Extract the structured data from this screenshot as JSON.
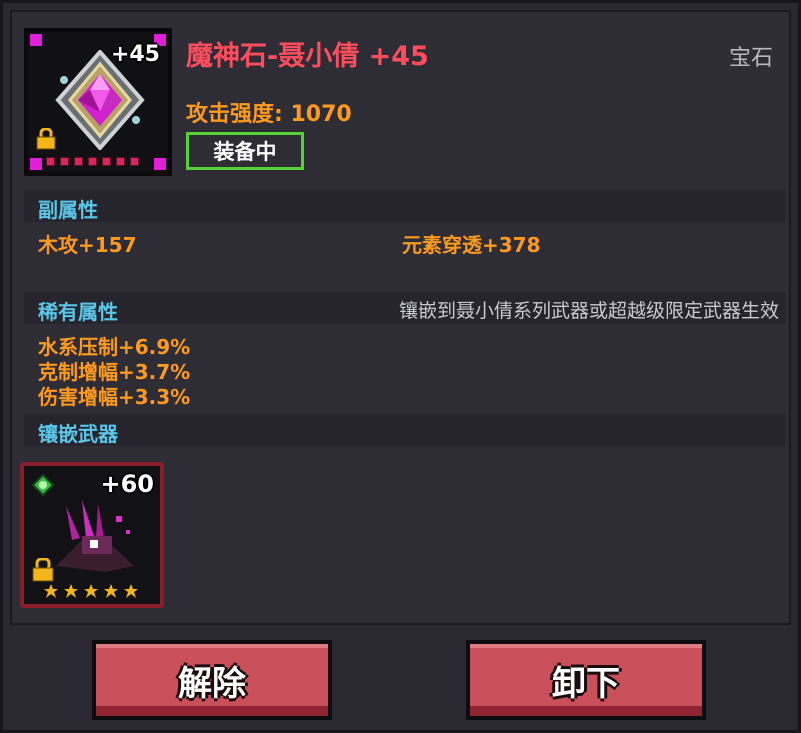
{
  "gem": {
    "name": "魔神石-聂小倩 +45",
    "level": "+45",
    "category": "宝石",
    "stat_label": "攻击强度:",
    "stat_value": "1070",
    "equipped_badge": "装备中",
    "colors": {
      "name": "#ff4d5e",
      "stat": "#ff9a1f",
      "frame": "#e01fd6",
      "gem": "#e63ad8"
    },
    "icon": "magenta-gem-icon"
  },
  "secondary": {
    "title": "副属性",
    "attrs": [
      "木攻+157",
      "元素穿透+378"
    ]
  },
  "rare": {
    "title": "稀有属性",
    "note": "镶嵌到聂小倩系列武器或超越级限定武器生效",
    "attrs": [
      "水系压制+6.9%",
      "克制增幅+3.7%",
      "伤害增幅+3.3%"
    ]
  },
  "weapon": {
    "title": "镶嵌武器",
    "level": "+60",
    "icon": "purple-claw-weapon-icon"
  },
  "buttons": {
    "remove": "解除",
    "unequip": "卸下"
  }
}
